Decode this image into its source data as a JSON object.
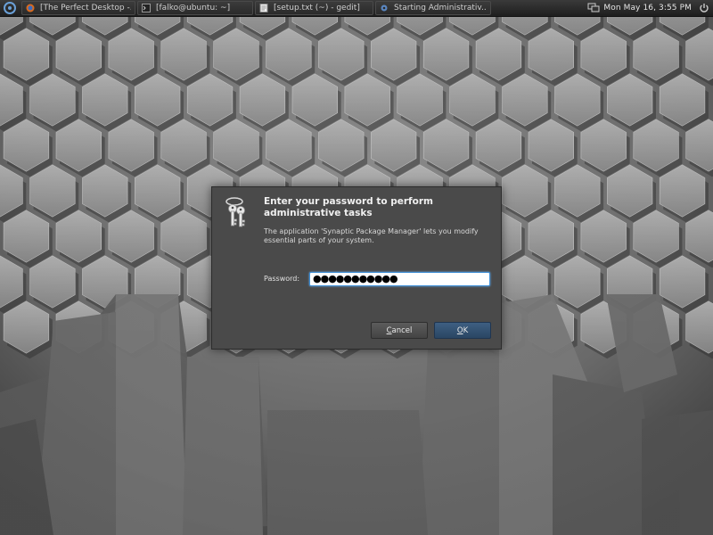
{
  "panel": {
    "tasks": [
      {
        "label": "[The Perfect Desktop -...",
        "icon": "firefox-icon"
      },
      {
        "label": "[falko@ubuntu: ~]",
        "icon": "terminal-icon"
      },
      {
        "label": "[setup.txt (~) - gedit]",
        "icon": "gedit-icon"
      },
      {
        "label": "Starting Administrativ...",
        "icon": "gear-icon"
      }
    ],
    "clock": "Mon May 16,  3:55 PM"
  },
  "dialog": {
    "title_line1": "Enter your password to perform",
    "title_line2": "administrative tasks",
    "desc_line1": "The application 'Synaptic Package Manager' lets you modify",
    "desc_line2": "essential parts of your system.",
    "password_label": "Password:",
    "password_value": "●●●●●●●●●●●",
    "cancel_label_u": "C",
    "cancel_label_rest": "ancel",
    "ok_label_u": "O",
    "ok_label_rest": "K"
  },
  "colors": {
    "panel_bg": "#262626",
    "dialog_bg": "#4a4a4a",
    "ok_button": "#34587c",
    "focus_ring": "#3d8ed6"
  }
}
